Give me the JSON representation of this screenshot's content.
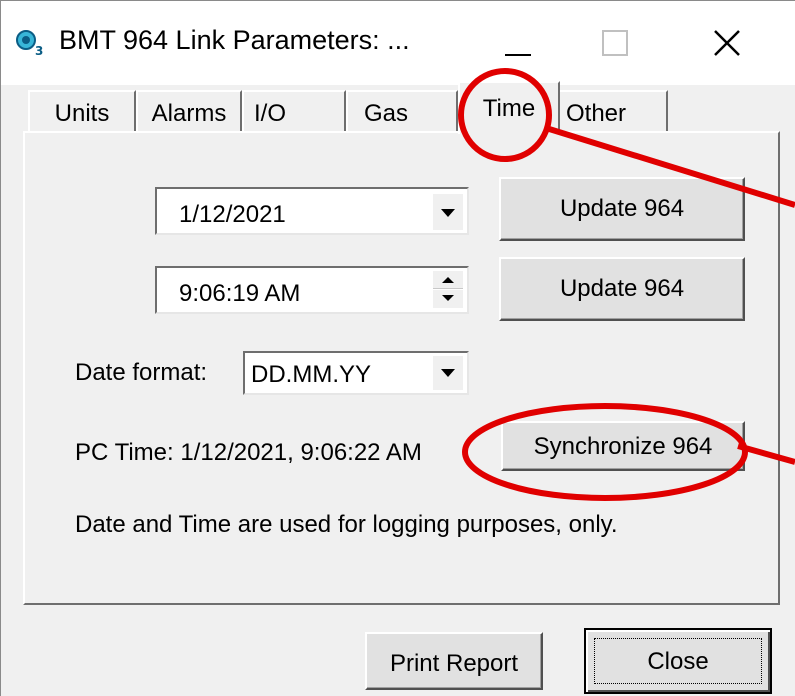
{
  "window": {
    "title": "BMT 964 Link Parameters: ...",
    "minimize_icon": "minimize-icon",
    "maximize_icon": "maximize-icon",
    "close_icon": "close-icon"
  },
  "tabs": [
    {
      "label": "Units",
      "selected": false
    },
    {
      "label": "Alarms",
      "selected": false
    },
    {
      "label": "I/O",
      "selected": false
    },
    {
      "label": "Gas",
      "selected": false
    },
    {
      "label": "Time",
      "selected": true
    },
    {
      "label": "Other",
      "selected": false
    }
  ],
  "time_tab": {
    "date_value": "1/12/2021",
    "time_value": "9:06:19 AM",
    "update_date_label": "Update 964",
    "update_time_label": "Update 964",
    "date_format_label": "Date format:",
    "date_format_value": "DD.MM.YY",
    "pc_time_text": "PC Time: 1/12/2021, 9:06:22 AM",
    "synchronize_label": "Synchronize 964",
    "info_text": "Date and Time are used for logging purposes, only."
  },
  "footer": {
    "print_label": "Print Report",
    "close_label": "Close"
  },
  "colors": {
    "annotation_red": "#e00000",
    "dialog_bg": "#f0f0f0",
    "button_face": "#e1e1e1"
  }
}
